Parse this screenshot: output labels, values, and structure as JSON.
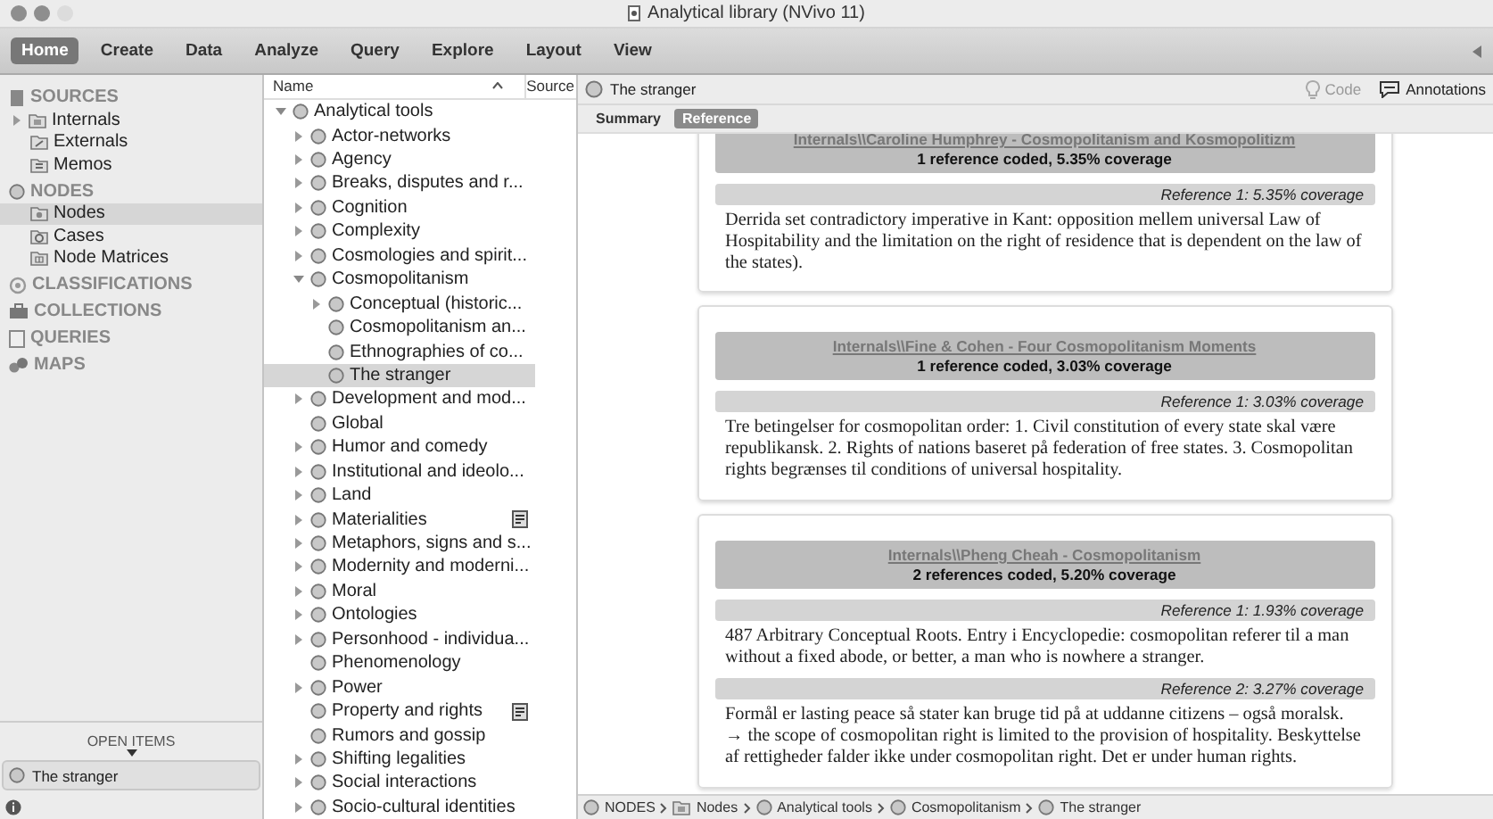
{
  "window": {
    "title": "Analytical library (NVivo 11)"
  },
  "ribbon_tabs": [
    {
      "label": "Home",
      "selected": true
    },
    {
      "label": "Create",
      "selected": false
    },
    {
      "label": "Data",
      "selected": false
    },
    {
      "label": "Analyze",
      "selected": false
    },
    {
      "label": "Query",
      "selected": false
    },
    {
      "label": "Explore",
      "selected": false
    },
    {
      "label": "Layout",
      "selected": false
    },
    {
      "label": "View",
      "selected": false
    }
  ],
  "sidebar": {
    "sections": [
      {
        "label": "SOURCES",
        "kind": "sources",
        "items": [
          {
            "label": "Internals",
            "kind": "internals",
            "expandable": true,
            "selected": false
          },
          {
            "label": "Externals",
            "kind": "externals",
            "selected": false
          },
          {
            "label": "Memos",
            "kind": "memos",
            "selected": false
          }
        ]
      },
      {
        "label": "NODES",
        "kind": "nodes",
        "items": [
          {
            "label": "Nodes",
            "kind": "nodes",
            "selected": true
          },
          {
            "label": "Cases",
            "kind": "cases",
            "selected": false
          },
          {
            "label": "Node Matrices",
            "kind": "matrices",
            "selected": false
          }
        ]
      },
      {
        "label": "CLASSIFICATIONS",
        "kind": "classifications"
      },
      {
        "label": "COLLECTIONS",
        "kind": "collections"
      },
      {
        "label": "QUERIES",
        "kind": "queries"
      },
      {
        "label": "MAPS",
        "kind": "maps"
      }
    ],
    "open_items_label": "OPEN ITEMS",
    "open_items": [
      {
        "label": "The stranger"
      }
    ]
  },
  "tree": {
    "columns": [
      "Name",
      "Source"
    ],
    "nodes": [
      {
        "label": "Analytical tools",
        "expanded": true,
        "selected": false,
        "children": [
          {
            "label": "Actor-networks",
            "expanded": false,
            "selected": false
          },
          {
            "label": "Agency",
            "expanded": false,
            "selected": false
          },
          {
            "label": "Breaks, disputes and r...",
            "expanded": false,
            "selected": false
          },
          {
            "label": "Cognition",
            "expanded": false,
            "selected": false
          },
          {
            "label": "Complexity",
            "expanded": false,
            "selected": false
          },
          {
            "label": "Cosmologies and spirit...",
            "expanded": false,
            "selected": false
          },
          {
            "label": "Cosmopolitanism",
            "expanded": true,
            "selected": false,
            "children": [
              {
                "label": "Conceptual (historic...",
                "expanded": false,
                "selected": false
              },
              {
                "label": "Cosmopolitanism an...",
                "selected": false
              },
              {
                "label": "Ethnographies of co...",
                "selected": false
              },
              {
                "label": "The stranger",
                "selected": true
              }
            ]
          },
          {
            "label": "Development and mod...",
            "expanded": false,
            "selected": false
          },
          {
            "label": "Global",
            "selected": false
          },
          {
            "label": "Humor and comedy",
            "expanded": false,
            "selected": false
          },
          {
            "label": "Institutional and ideolo...",
            "expanded": false,
            "selected": false
          },
          {
            "label": "Land",
            "expanded": false,
            "selected": false
          },
          {
            "label": "Materialities",
            "expanded": false,
            "selected": false,
            "memo": true
          },
          {
            "label": "Metaphors, signs and s...",
            "expanded": false,
            "selected": false
          },
          {
            "label": "Modernity and moderni...",
            "expanded": false,
            "selected": false
          },
          {
            "label": "Moral",
            "expanded": false,
            "selected": false
          },
          {
            "label": "Ontologies",
            "expanded": false,
            "selected": false
          },
          {
            "label": "Personhood - individua...",
            "expanded": false,
            "selected": false
          },
          {
            "label": "Phenomenology",
            "selected": false
          },
          {
            "label": "Power",
            "expanded": false,
            "selected": false
          },
          {
            "label": "Property and rights",
            "selected": false,
            "memo": true
          },
          {
            "label": "Rumors and gossip",
            "selected": false
          },
          {
            "label": "Shifting legalities",
            "expanded": false,
            "selected": false
          },
          {
            "label": "Social interactions",
            "expanded": false,
            "selected": false
          },
          {
            "label": "Socio-cultural identities",
            "expanded": false,
            "selected": false
          }
        ]
      }
    ]
  },
  "detail": {
    "title": "The stranger",
    "actions": [
      {
        "label": "Code",
        "kind": "code",
        "disabled": true
      },
      {
        "label": "Annotations",
        "kind": "annotations",
        "disabled": false
      }
    ],
    "tabs": [
      {
        "label": "Summary",
        "selected": false
      },
      {
        "label": "Reference",
        "selected": true
      }
    ],
    "cards": [
      {
        "source": "Internals\\\\Caroline Humphrey - Cosmopolitanism and Kosmopolitizm",
        "summary": "1 reference coded, 5.35% coverage",
        "references": [
          {
            "label": "Reference 1: 5.35% coverage",
            "text": "Derrida set contradictory imperative in Kant: opposition mellem universal Law of Hospitability and the limitation on the right of residence that is dependent on the law of the states)."
          }
        ]
      },
      {
        "source": "Internals\\\\Fine & Cohen - Four Cosmopolitanism Moments",
        "summary": "1 reference coded, 3.03% coverage",
        "references": [
          {
            "label": "Reference 1: 3.03% coverage",
            "text": "Tre betingelser for cosmopolitan order: 1. Civil constitution of every state skal være republikansk. 2. Rights of nations baseret på federation of free states. 3. Cosmopolitan rights begrænses til conditions of universal hospitality."
          }
        ]
      },
      {
        "source": "Internals\\\\Pheng Cheah - Cosmopolitanism",
        "summary": "2 references coded, 5.20% coverage",
        "references": [
          {
            "label": "Reference 1: 1.93% coverage",
            "text": "487  Arbitrary Conceptual Roots. Entry i Encyclopedie: cosmopolitan referer til a man without a fixed abode, or better, a man who is nowhere a stranger."
          },
          {
            "label": "Reference 2: 3.27% coverage",
            "text": "Formål er lasting peace så stater kan bruge tid på at uddanne citizens – også moralsk. → the scope of cosmopolitan right is limited to the provision of hospitality. Beskyttelse af rettigheder falder ikke under cosmopolitan right. Det er under human rights."
          }
        ]
      }
    ],
    "breadcrumb": [
      {
        "label": "NODES",
        "kind": "node"
      },
      {
        "label": "Nodes",
        "kind": "folder"
      },
      {
        "label": "Analytical tools",
        "kind": "node"
      },
      {
        "label": "Cosmopolitanism",
        "kind": "node"
      },
      {
        "label": "The stranger",
        "kind": "node"
      }
    ]
  }
}
